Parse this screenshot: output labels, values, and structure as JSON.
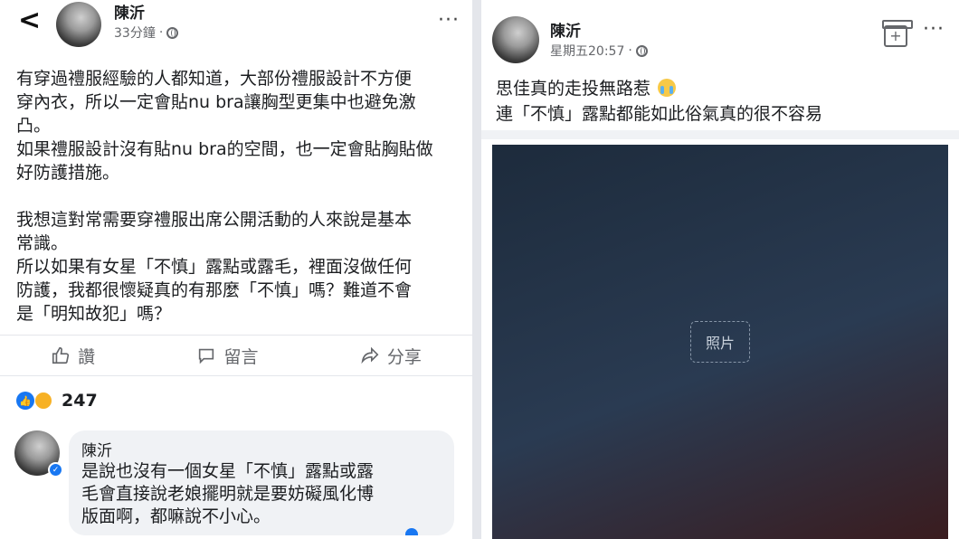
{
  "left_post": {
    "back_glyph": "<",
    "author": "陳沂",
    "timestamp": "33分鐘",
    "more_glyph": "···",
    "paragraphs": [
      "有穿過禮服經驗的人都知道，大部份禮服設計不方便\n穿內衣，所以一定會貼nu bra讓胸型更集中也避免激\n凸。",
      "如果禮服設計沒有貼nu bra的空間，也一定會貼胸貼做\n好防護措施。",
      "",
      "我想這對常需要穿禮服出席公開活動的人來說是基本\n常識。",
      "所以如果有女星「不慎」露點或露毛，裡面沒做任何\n防護，我都很懷疑真的有那麼「不慎」嗎？難道不會\n是「明知故犯」嗎？"
    ],
    "actions": {
      "like": "讚",
      "comment": "留言",
      "share": "分享"
    },
    "reaction_count": "247",
    "comment": {
      "author": "陳沂",
      "text": "是說也沒有一個女星「不慎」露點或露\n毛會直接說老娘擺明就是要妨礙風化博\n版面啊，都嘛說不小心。"
    }
  },
  "right_post": {
    "author": "陳沂",
    "timestamp": "星期五20:57",
    "more_glyph": "···",
    "lines": [
      "思佳真的走投無路惹",
      "連「不慎」露點都能如此俗氣真的很不容易"
    ],
    "photo_placeholder": "照片"
  },
  "colors": {
    "facebook_blue": "#1877f2",
    "meta_gray": "#65676b"
  }
}
